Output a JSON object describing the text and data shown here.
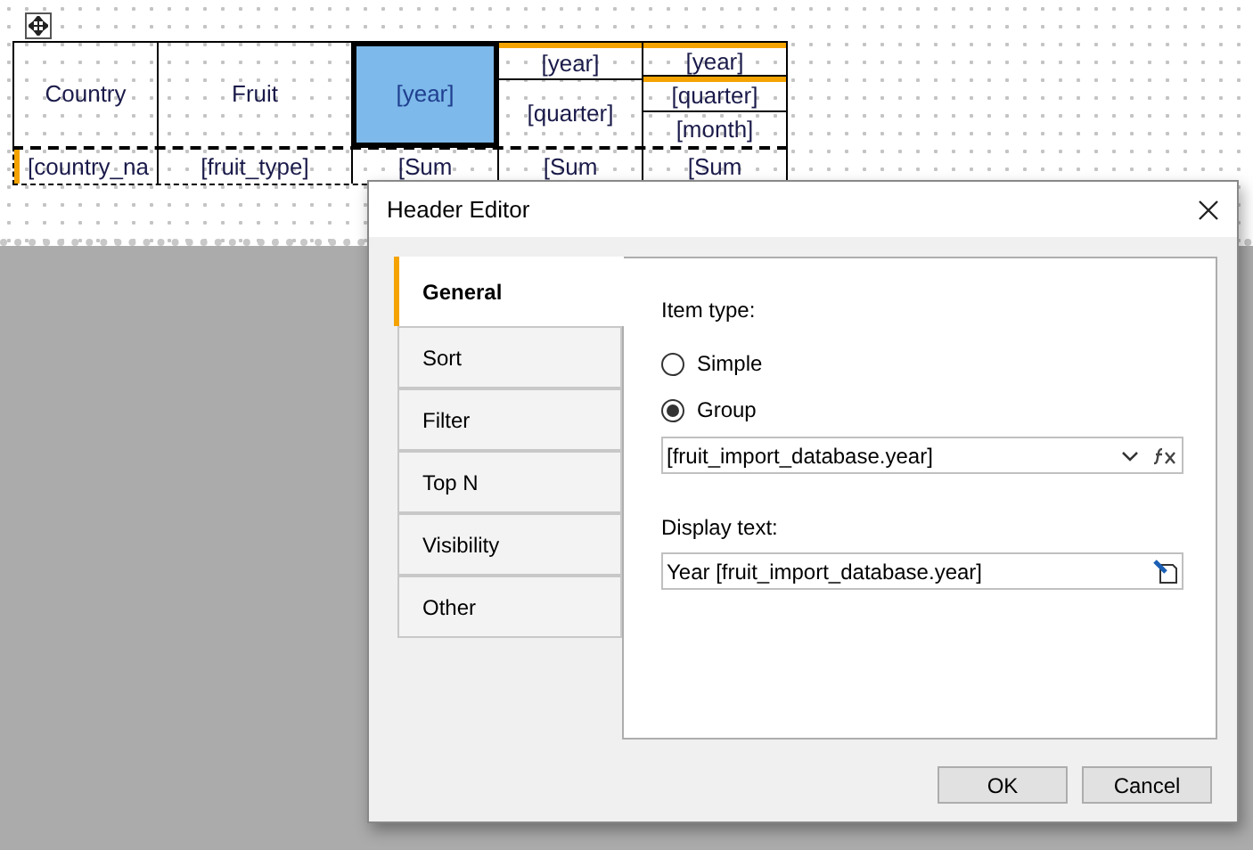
{
  "table": {
    "header_columns": [
      {
        "cells": [
          {
            "text": "Country",
            "selected": false,
            "flagged": false
          }
        ]
      },
      {
        "cells": [
          {
            "text": "Fruit",
            "selected": false,
            "flagged": false
          }
        ]
      },
      {
        "cells": [
          {
            "text": "[year]",
            "selected": true,
            "flagged": false
          }
        ]
      },
      {
        "cells": [
          {
            "text": "[year]",
            "selected": false,
            "flagged": true
          },
          {
            "text": "[quarter]",
            "selected": false,
            "flagged": false
          }
        ]
      },
      {
        "cells": [
          {
            "text": "[year]",
            "selected": false,
            "flagged": true
          },
          {
            "text": "[quarter]",
            "selected": false,
            "flagged": true
          },
          {
            "text": "[month]",
            "selected": false,
            "flagged": false
          }
        ]
      }
    ],
    "data_row": [
      {
        "text": "[country_na",
        "flagged": true
      },
      {
        "text": "[fruit_type]",
        "flagged": false
      },
      {
        "text": "[Sum",
        "flagged": false
      },
      {
        "text": "[Sum",
        "flagged": false
      },
      {
        "text": "[Sum",
        "flagged": false
      }
    ]
  },
  "dialog": {
    "title": "Header Editor",
    "tabs": [
      {
        "label": "General",
        "selected": true
      },
      {
        "label": "Sort",
        "selected": false
      },
      {
        "label": "Filter",
        "selected": false
      },
      {
        "label": "Top N",
        "selected": false
      },
      {
        "label": "Visibility",
        "selected": false
      },
      {
        "label": "Other",
        "selected": false
      }
    ],
    "item_type_label": "Item type:",
    "item_types": [
      {
        "label": "Simple",
        "selected": false
      },
      {
        "label": "Group",
        "selected": true
      }
    ],
    "group_field": "[fruit_import_database.year]",
    "display_text_label": "Display text:",
    "display_text": "Year [fruit_import_database.year]",
    "buttons": [
      "OK",
      "Cancel"
    ]
  }
}
